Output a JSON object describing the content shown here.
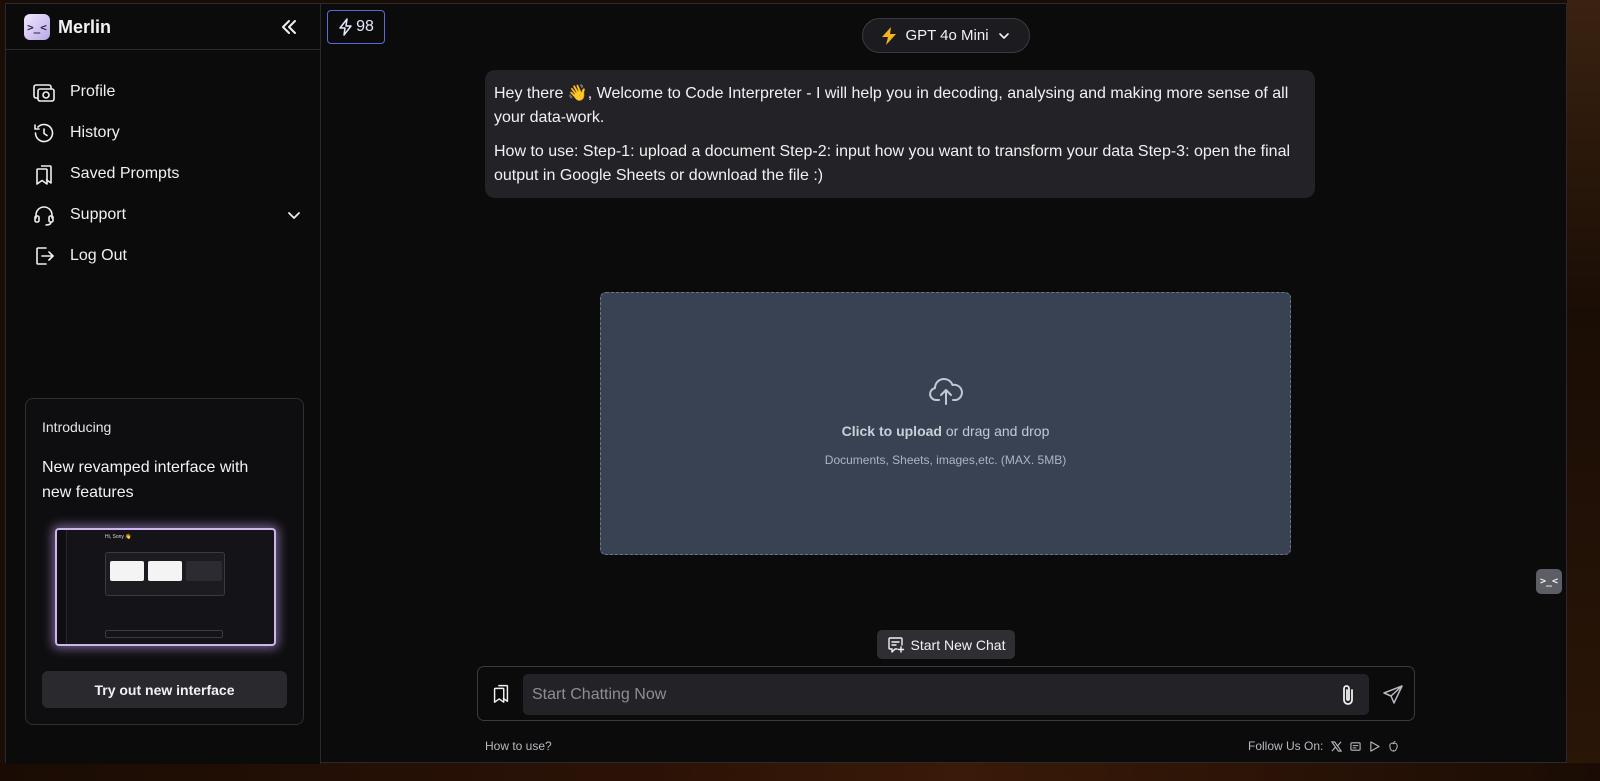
{
  "brand": {
    "name": "Merlin",
    "logo_glyph": ">_<"
  },
  "sidebar": {
    "items": [
      {
        "label": "Profile",
        "icon": "profile-camera-icon"
      },
      {
        "label": "History",
        "icon": "history-icon"
      },
      {
        "label": "Saved Prompts",
        "icon": "bookmark-icon"
      },
      {
        "label": "Support",
        "icon": "headset-icon",
        "has_dropdown": true
      },
      {
        "label": "Log Out",
        "icon": "logout-icon"
      }
    ],
    "promo": {
      "kicker": "Introducing",
      "title": "New revamped interface with new features",
      "preview_heading": "Hi, Sony 👋",
      "button": "Try out new interface"
    }
  },
  "header": {
    "credits": "98",
    "model": "GPT 4o Mini"
  },
  "message": {
    "para1": "Hey there  👋, Welcome to Code Interpreter - I will help you in decoding, analysing and making more sense of all your data-work.",
    "para2": "How to use: Step-1: upload a document Step-2: input how you want to transform your data Step-3: open the final output in Google Sheets or download the file :)"
  },
  "upload": {
    "cta": "Click to upload",
    "cta_rest": " or drag and drop",
    "hint": "Documents, Sheets, images,etc. (MAX. 5MB)"
  },
  "composer": {
    "new_chat": "Start New Chat",
    "placeholder": "Start Chatting Now"
  },
  "footer": {
    "how_to": "How to use?",
    "follow": "Follow Us On:"
  },
  "colors": {
    "background": "#0b0b0c",
    "credits_border": "#5a6ad8",
    "upload_bg": "#384253",
    "model_bolt": "#f5b41c"
  }
}
